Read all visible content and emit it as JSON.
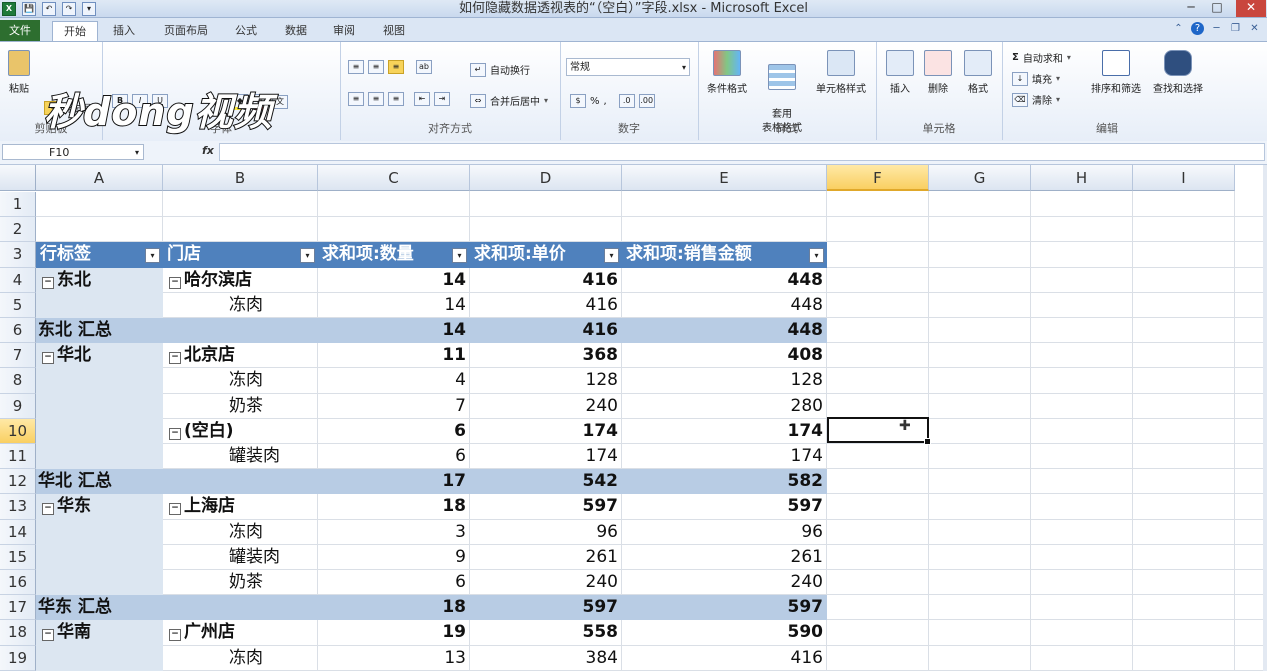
{
  "window": {
    "title": "如何隐藏数据透视表的“（空白）”字段.xlsx - Microsoft Excel",
    "controls": [
      "─",
      "□",
      "✕"
    ]
  },
  "quick_access": [
    "X",
    "💾",
    "↶",
    "↷",
    "▾"
  ],
  "tabs": {
    "file": "文件",
    "items": [
      "开始",
      "插入",
      "页面布局",
      "公式",
      "数据",
      "审阅",
      "视图"
    ],
    "active": "开始"
  },
  "ribbon": {
    "clipboard": {
      "paste": "粘贴",
      "format_painter": "格式刷",
      "label": "剪贴板"
    },
    "font": {
      "label": "字体",
      "bold": "B",
      "italic": "I",
      "underline": "U",
      "font_color": "A"
    },
    "alignment": {
      "wrap": "自动换行",
      "merge": "合并后居中",
      "label": "对齐方式"
    },
    "number": {
      "format": "常规",
      "percent": "%",
      "comma": ",",
      "label": "数字"
    },
    "styles": {
      "conditional": "条件格式",
      "table": "套用\n表格格式",
      "cell_styles": "单元格样式",
      "label": "样式"
    },
    "cells": {
      "insert": "插入",
      "delete": "删除",
      "format": "格式",
      "label": "单元格"
    },
    "editing": {
      "autosum": "自动求和",
      "fill": "填充",
      "clear": "清除",
      "sort_filter": "排序和筛选",
      "find_select": "查找和选择",
      "label": "编辑"
    }
  },
  "watermark": "秒dong视频",
  "formula_bar": {
    "name_box": "F10",
    "fx": "fx",
    "value": ""
  },
  "columns": [
    "A",
    "B",
    "C",
    "D",
    "E",
    "F",
    "G",
    "H",
    "I"
  ],
  "selected_column": "F",
  "rows": [
    "1",
    "2",
    "3",
    "4",
    "5",
    "6",
    "7",
    "8",
    "9",
    "10",
    "11",
    "12",
    "13",
    "14",
    "15",
    "16",
    "17",
    "18",
    "19"
  ],
  "selected_row": "10",
  "pivot": {
    "headers": [
      "行标签",
      "门店",
      "求和项:数量",
      "求和项:单价",
      "求和项:销售金额"
    ],
    "rows": [
      {
        "r": 4,
        "a": "东北",
        "a_toggle": true,
        "b": "哈尔滨店",
        "b_toggle": true,
        "c": "14",
        "d": "416",
        "e": "448",
        "bold": true
      },
      {
        "r": 5,
        "a": "",
        "b": "冻肉",
        "indent": true,
        "c": "14",
        "d": "416",
        "e": "448"
      },
      {
        "r": 6,
        "a": "东北 汇总",
        "subtotal": true,
        "c": "14",
        "d": "416",
        "e": "448"
      },
      {
        "r": 7,
        "a": "华北",
        "a_toggle": true,
        "b": "北京店",
        "b_toggle": true,
        "c": "11",
        "d": "368",
        "e": "408",
        "bold": true
      },
      {
        "r": 8,
        "a": "",
        "b": "冻肉",
        "indent": true,
        "c": "4",
        "d": "128",
        "e": "128"
      },
      {
        "r": 9,
        "a": "",
        "b": "奶茶",
        "indent": true,
        "c": "7",
        "d": "240",
        "e": "280"
      },
      {
        "r": 10,
        "a": "",
        "b": "(空白)",
        "b_toggle": true,
        "c": "6",
        "d": "174",
        "e": "174",
        "bold": true
      },
      {
        "r": 11,
        "a": "",
        "b": "罐装肉",
        "indent": true,
        "c": "6",
        "d": "174",
        "e": "174"
      },
      {
        "r": 12,
        "a": "华北 汇总",
        "subtotal": true,
        "c": "17",
        "d": "542",
        "e": "582"
      },
      {
        "r": 13,
        "a": "华东",
        "a_toggle": true,
        "b": "上海店",
        "b_toggle": true,
        "c": "18",
        "d": "597",
        "e": "597",
        "bold": true
      },
      {
        "r": 14,
        "a": "",
        "b": "冻肉",
        "indent": true,
        "c": "3",
        "d": "96",
        "e": "96"
      },
      {
        "r": 15,
        "a": "",
        "b": "罐装肉",
        "indent": true,
        "c": "9",
        "d": "261",
        "e": "261"
      },
      {
        "r": 16,
        "a": "",
        "b": "奶茶",
        "indent": true,
        "c": "6",
        "d": "240",
        "e": "240"
      },
      {
        "r": 17,
        "a": "华东 汇总",
        "subtotal": true,
        "c": "18",
        "d": "597",
        "e": "597"
      },
      {
        "r": 18,
        "a": "华南",
        "a_toggle": true,
        "b": "广州店",
        "b_toggle": true,
        "c": "19",
        "d": "558",
        "e": "590",
        "bold": true
      },
      {
        "r": 19,
        "a": "",
        "b": "冻肉",
        "indent": true,
        "c": "13",
        "d": "384",
        "e": "416"
      }
    ]
  },
  "colors": {
    "header_fill": "#4f81bd",
    "subtotal_fill": "#b8cce4",
    "row_label_fill": "#dce6f1",
    "selection_header": "#f9cf62"
  }
}
